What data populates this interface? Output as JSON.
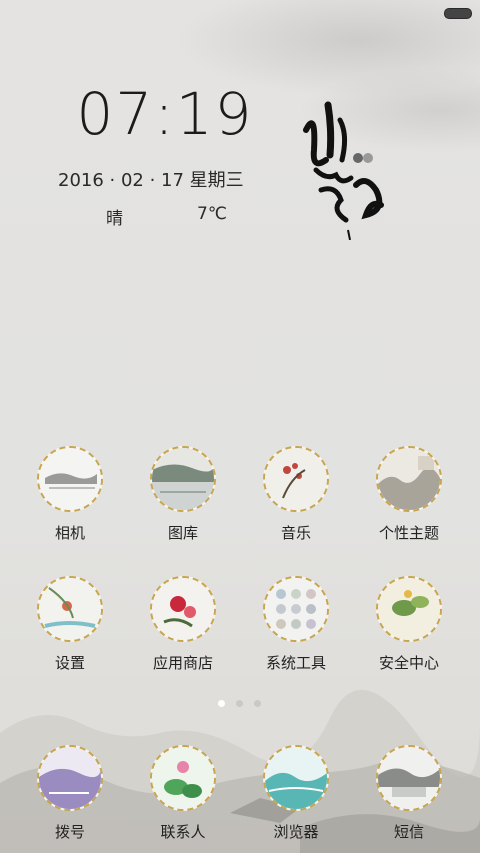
{
  "status": {
    "battery_icon": "battery-icon"
  },
  "lockscreen": {
    "time": "07:19",
    "date": "2016 · 02 · 17 星期三",
    "weather_condition": "晴",
    "temperature": "7℃"
  },
  "apps_row1": [
    {
      "label": "相机",
      "icon": "camera-icon"
    },
    {
      "label": "图库",
      "icon": "gallery-icon"
    },
    {
      "label": "音乐",
      "icon": "music-icon"
    },
    {
      "label": "个性主题",
      "icon": "theme-icon"
    }
  ],
  "apps_row2": [
    {
      "label": "设置",
      "icon": "settings-icon"
    },
    {
      "label": "应用商店",
      "icon": "app-store-icon"
    },
    {
      "label": "系统工具",
      "icon": "system-tools-icon"
    },
    {
      "label": "安全中心",
      "icon": "security-center-icon"
    }
  ],
  "dock": [
    {
      "label": "拨号",
      "icon": "dialer-icon"
    },
    {
      "label": "联系人",
      "icon": "contacts-icon"
    },
    {
      "label": "浏览器",
      "icon": "browser-icon"
    },
    {
      "label": "短信",
      "icon": "messages-icon"
    }
  ],
  "page_indicator": {
    "count": 3,
    "active": 1
  },
  "colors": {
    "icon_ring": "#c8a650",
    "background": "#e2e2e0"
  }
}
